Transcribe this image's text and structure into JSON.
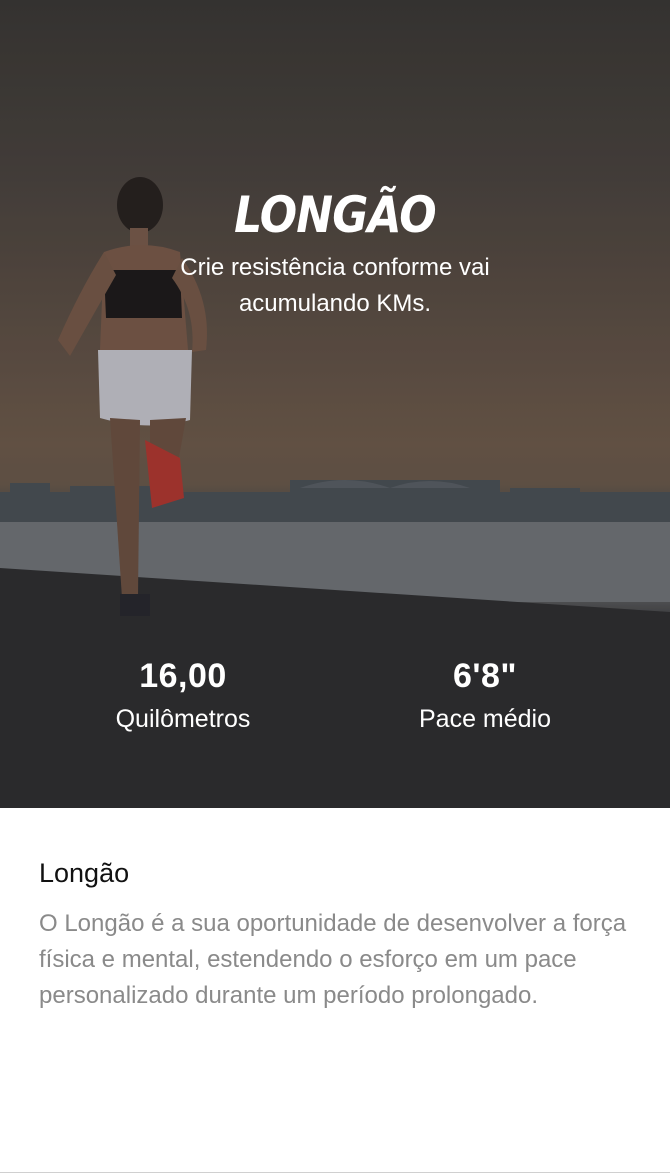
{
  "hero": {
    "title": "LONGÃO",
    "subtitle": "Crie resistência conforme vai acumulando KMs.",
    "image": "woman-running-by-the-sea-photo"
  },
  "stats": [
    {
      "value": "16,00",
      "label": "Quilômetros"
    },
    {
      "value": "6'8\"",
      "label": "Pace médio"
    }
  ],
  "details": {
    "title": "Longão",
    "description": "O Longão é a sua oportunidade de desenvolver a força física e mental, estendendo o esforço em um pace personalizado durante um período prolongado."
  },
  "colors": {
    "hero_text": "#ffffff",
    "title_text": "#111111",
    "body_text": "#8a8a8a"
  }
}
